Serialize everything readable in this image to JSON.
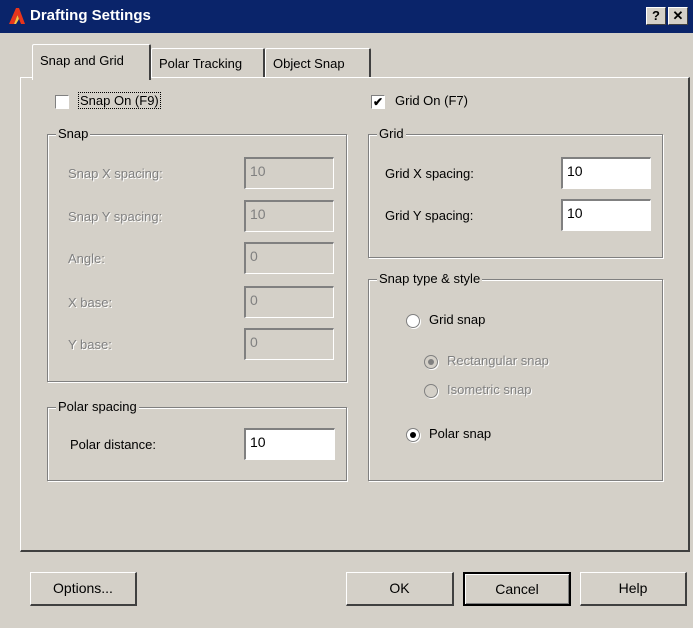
{
  "window": {
    "title": "Drafting Settings",
    "help_glyph": "?",
    "close_glyph": "✕",
    "app_icon": "autocad-icon"
  },
  "tabs": [
    {
      "label": "Snap and Grid",
      "active": true
    },
    {
      "label": "Polar Tracking",
      "active": false
    },
    {
      "label": "Object Snap",
      "active": false
    }
  ],
  "snap_on": {
    "label": "Snap On (F9)",
    "checked": false
  },
  "grid_on": {
    "label": "Grid On (F7)",
    "checked": true
  },
  "snap_group": {
    "title": "Snap",
    "rows": [
      {
        "label": "Snap X spacing:",
        "value": "10"
      },
      {
        "label": "Snap Y spacing:",
        "value": "10"
      },
      {
        "label": "Angle:",
        "value": "0"
      },
      {
        "label": "X base:",
        "value": "0"
      },
      {
        "label": "Y base:",
        "value": "0"
      }
    ]
  },
  "polar_spacing": {
    "title": "Polar spacing",
    "label": "Polar distance:",
    "value": "10"
  },
  "grid_group": {
    "title": "Grid",
    "rows": [
      {
        "label": "Grid X spacing:",
        "value": "10"
      },
      {
        "label": "Grid Y spacing:",
        "value": "10"
      }
    ]
  },
  "snap_type": {
    "title": "Snap type & style",
    "grid_snap": "Grid snap",
    "rectangular_snap": "Rectangular snap",
    "isometric_snap": "Isometric snap",
    "polar_snap": "Polar snap"
  },
  "buttons": {
    "options": "Options...",
    "ok": "OK",
    "cancel": "Cancel",
    "help": "Help"
  }
}
